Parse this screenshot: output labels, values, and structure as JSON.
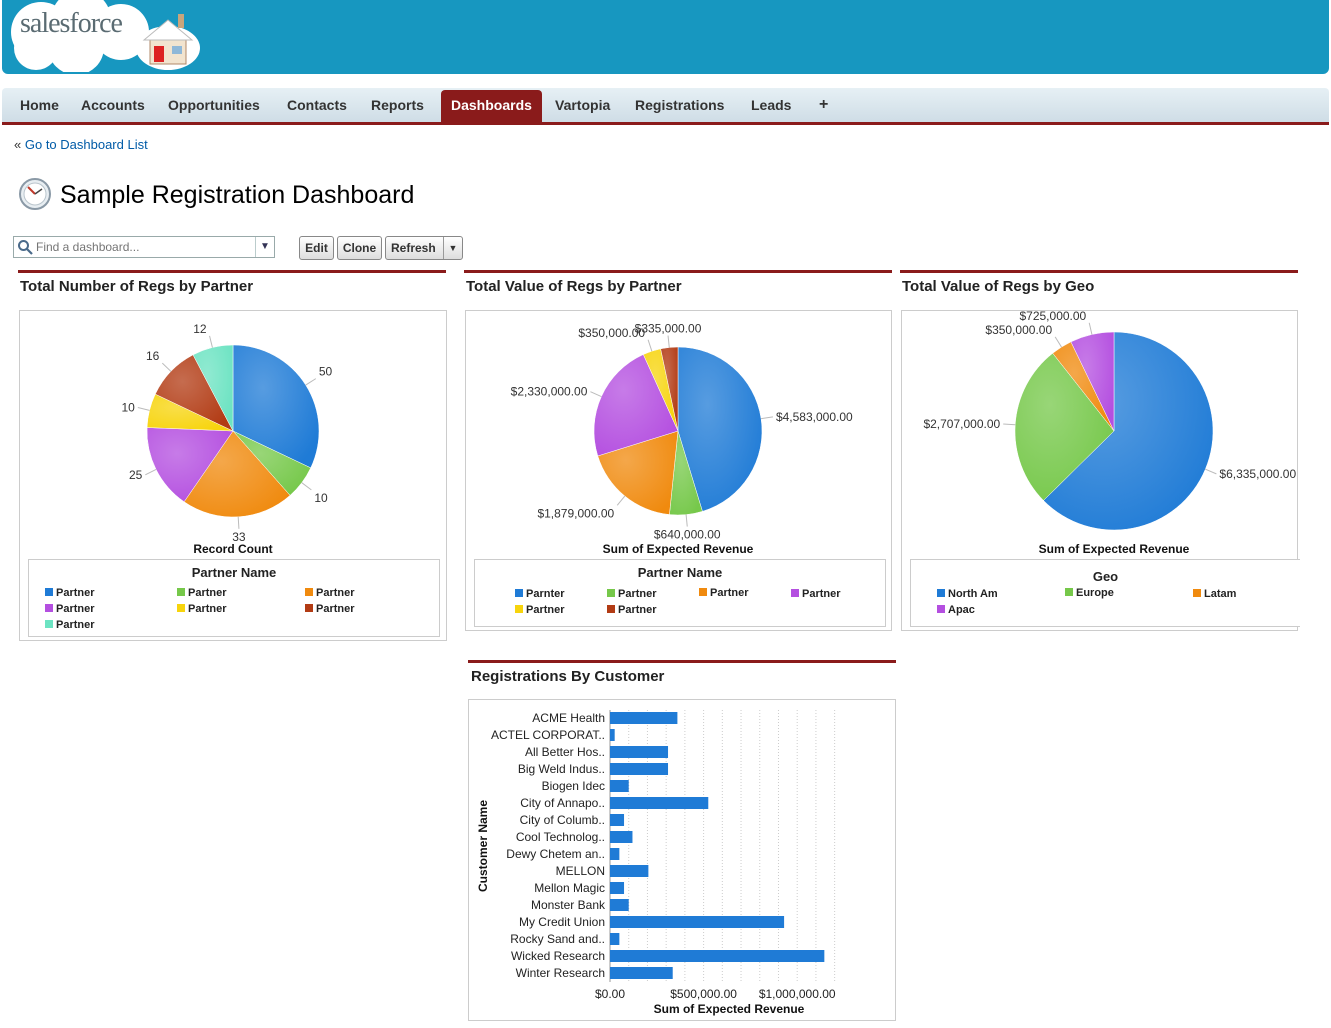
{
  "brand": {
    "logo_text": "salesforce"
  },
  "nav": {
    "tabs": [
      {
        "label": "Home"
      },
      {
        "label": "Accounts"
      },
      {
        "label": "Opportunities"
      },
      {
        "label": "Contacts"
      },
      {
        "label": "Reports"
      },
      {
        "label": "Dashboards",
        "active": true
      },
      {
        "label": "Vartopia"
      },
      {
        "label": "Registrations"
      },
      {
        "label": "Leads"
      },
      {
        "label": "+"
      }
    ]
  },
  "back_link": {
    "prefix": "«",
    "label": "Go to Dashboard List"
  },
  "page": {
    "title": "Sample Registration Dashboard"
  },
  "search": {
    "placeholder": "Find a dashboard..."
  },
  "toolbar": {
    "edit": "Edit",
    "clone": "Clone",
    "refresh": "Refresh"
  },
  "colors": {
    "accent": "#8a1b1b",
    "header": "#1797c0",
    "link": "#015ba7"
  },
  "panels": {
    "p1": {
      "title": "Total Number of Regs by Partner",
      "legend_title": "Partner Name",
      "legend": [
        "Partner",
        "Partner",
        "Partner",
        "Partner",
        "Partner",
        "Partner",
        "Partner"
      ]
    },
    "p2": {
      "title": "Total Value of Regs by Partner",
      "legend_title": "Partner Name",
      "legend": [
        "Parnter",
        "Partner",
        "Partner",
        "Partner",
        "Partner",
        "Partner"
      ]
    },
    "p3": {
      "title": "Total Value of Regs by Geo",
      "legend_title": "Geo",
      "legend": [
        "North Am",
        "Europe",
        "Latam",
        "Apac"
      ]
    },
    "p4": {
      "title": "Registrations By Customer"
    }
  },
  "chart_data": [
    {
      "type": "pie",
      "title": "Total Number of Regs by Partner",
      "xlabel": "Record Count",
      "legend_title": "Partner Name",
      "slices": [
        {
          "label": "50",
          "value": 50,
          "color": "#1f7bd6"
        },
        {
          "label": "10",
          "value": 10,
          "color": "#76c84a"
        },
        {
          "label": "33",
          "value": 33,
          "color": "#f08a0e"
        },
        {
          "label": "25",
          "value": 25,
          "color": "#b44fe0"
        },
        {
          "label": "10",
          "value": 10,
          "color": "#f7d40c"
        },
        {
          "label": "16",
          "value": 16,
          "color": "#b23b14"
        },
        {
          "label": "12",
          "value": 12,
          "color": "#6ce3c2"
        }
      ]
    },
    {
      "type": "pie",
      "title": "Total Value of Regs by Partner",
      "xlabel": "Sum of Expected Revenue",
      "legend_title": "Partner Name",
      "slices": [
        {
          "label": "$4,583,000.00",
          "value": 4583000,
          "color": "#1f7bd6"
        },
        {
          "label": "$640,000.00",
          "value": 640000,
          "color": "#76c84a"
        },
        {
          "label": "$1,879,000.00",
          "value": 1879000,
          "color": "#f08a0e"
        },
        {
          "label": "$2,330,000.00",
          "value": 2330000,
          "color": "#b44fe0"
        },
        {
          "label": "$350,000.00",
          "value": 350000,
          "color": "#f7d40c"
        },
        {
          "label": "$335,000.00",
          "value": 335000,
          "color": "#b23b14"
        }
      ]
    },
    {
      "type": "pie",
      "title": "Total Value of Regs by Geo",
      "xlabel": "Sum of Expected Revenue",
      "legend_title": "Geo",
      "slices": [
        {
          "label": "$6,335,000.00",
          "value": 6335000,
          "color": "#1f7bd6"
        },
        {
          "label": "$2,707,000.00",
          "value": 2707000,
          "color": "#76c84a"
        },
        {
          "label": "$350,000.00",
          "value": 350000,
          "color": "#f08a0e"
        },
        {
          "label": "$725,000.00",
          "value": 725000,
          "color": "#b44fe0"
        }
      ]
    },
    {
      "type": "bar",
      "orientation": "horizontal",
      "title": "Registrations By Customer",
      "xlabel": "Sum of Expected Revenue",
      "ylabel": "Customer Name",
      "xlim": [
        0,
        1250000
      ],
      "xticks": [
        "$0.00",
        "$500,000.00",
        "$1,000,000.00"
      ],
      "xtick_values": [
        0,
        500000,
        1000000
      ],
      "categories": [
        "ACME Health",
        "ACTEL CORPORAT..",
        "All Better Hos..",
        "Big Weld Indus..",
        "Biogen Idec",
        "City of Annapo..",
        "City of Columb..",
        "Cool Technolog..",
        "Dewy Chetem an..",
        "MELLON",
        "Mellon Magic",
        "Monster Bank",
        "My Credit Union",
        "Rocky Sand and..",
        "Wicked Research",
        "Winter Research"
      ],
      "values": [
        360000,
        25000,
        310000,
        310000,
        100000,
        525000,
        75000,
        120000,
        50000,
        205000,
        75000,
        100000,
        930000,
        50000,
        1145000,
        335000
      ],
      "color": "#1f7bd6"
    }
  ]
}
